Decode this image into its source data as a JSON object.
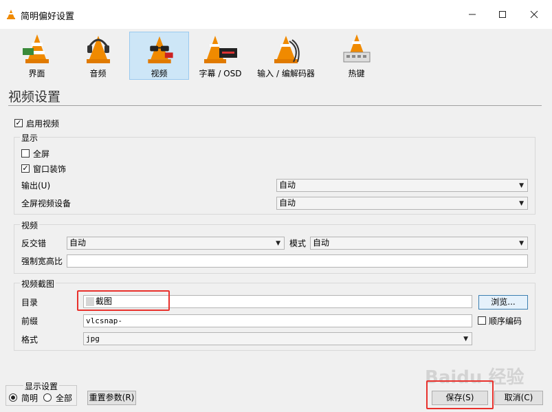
{
  "window": {
    "title": "简明偏好设置"
  },
  "categories": [
    {
      "label": "界面"
    },
    {
      "label": "音频"
    },
    {
      "label": "视频"
    },
    {
      "label": "字幕 / OSD"
    },
    {
      "label": "输入 / 编解码器"
    },
    {
      "label": "热键"
    }
  ],
  "page": {
    "title": "视频设置"
  },
  "enable_video": {
    "label": "启用视频",
    "checked": true
  },
  "display": {
    "legend": "显示",
    "fullscreen_label": "全屏",
    "decorations_label": "窗口装饰",
    "output_label": "输出(U)",
    "output_value": "自动",
    "fs_device_label": "全屏视频设备",
    "fs_device_value": "自动"
  },
  "video": {
    "legend": "视频",
    "deinterlace_label": "反交错",
    "deinterlace_value": "自动",
    "mode_label": "模式",
    "mode_value": "自动",
    "aspect_label": "强制宽高比",
    "aspect_value": ""
  },
  "snapshot": {
    "legend": "视频截图",
    "dir_label": "目录",
    "dir_value": "截图",
    "browse_label": "浏览...",
    "prefix_label": "前缀",
    "prefix_value": "vlcsnap-",
    "seq_label": "顺序编码",
    "format_label": "格式",
    "format_value": "jpg"
  },
  "show_settings": {
    "legend": "显示设置",
    "simple_label": "简明",
    "all_label": "全部",
    "selected": "简明"
  },
  "buttons": {
    "reset": "重置参数(R)",
    "save": "保存(S)",
    "cancel": "取消(C)"
  },
  "watermark": {
    "text": "Baidu 经验"
  },
  "colors": {
    "accent_selected": "#cde6f7",
    "highlight_red": "#e8302b",
    "cone_orange": "#f08a00"
  }
}
